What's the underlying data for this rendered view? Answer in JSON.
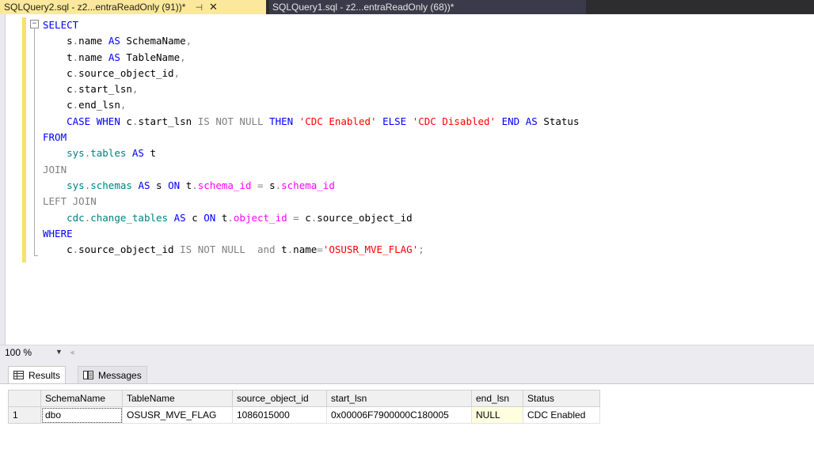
{
  "tabs": {
    "active_label": "SQLQuery2.sql - z2...entraReadOnly (91))*",
    "pin_glyph": "⊣",
    "close_glyph": "✕",
    "inactive_label": "SQLQuery1.sql - z2...entraReadOnly (68))*"
  },
  "editor": {
    "collapse_glyph": "−",
    "lines": [
      "SELECT",
      "    s.name AS SchemaName,",
      "    t.name AS TableName,",
      "    c.source_object_id,",
      "    c.start_lsn,",
      "    c.end_lsn,",
      "    CASE WHEN c.start_lsn IS NOT NULL THEN 'CDC Enabled' ELSE 'CDC Disabled' END AS Status",
      "FROM",
      "    sys.tables AS t",
      "JOIN",
      "    sys.schemas AS s ON t.schema_id = s.schema_id",
      "LEFT JOIN",
      "    cdc.change_tables AS c ON t.object_id = c.source_object_id",
      "WHERE",
      "    c.source_object_id IS NOT NULL  and t.name='OSUSR_MVE_FLAG';"
    ]
  },
  "zoom": {
    "value": "100 %"
  },
  "results_tabs": {
    "results": "Results",
    "messages": "Messages"
  },
  "grid": {
    "columns": [
      "SchemaName",
      "TableName",
      "source_object_id",
      "start_lsn",
      "end_lsn",
      "Status"
    ],
    "rows": [
      {
        "num": "1",
        "cells": [
          "dbo",
          "OSUSR_MVE_FLAG",
          "1086015000",
          "0x00006F7900000C180005",
          "NULL",
          "CDC Enabled"
        ]
      }
    ]
  }
}
